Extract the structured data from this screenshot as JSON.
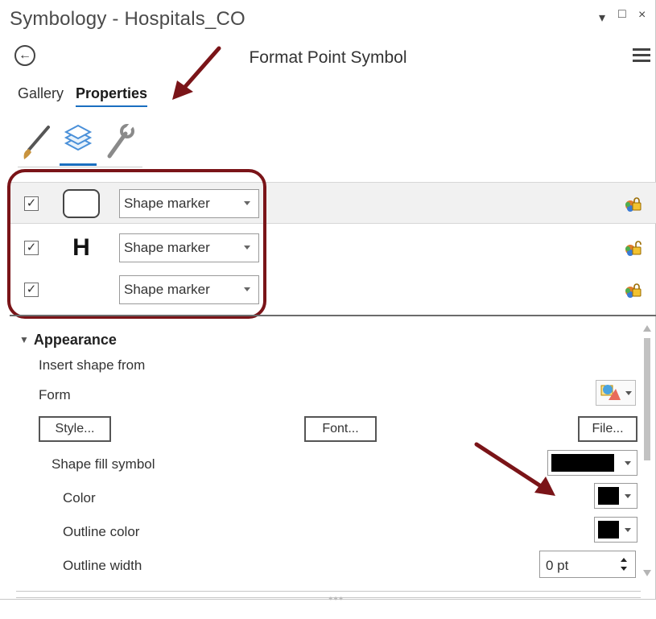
{
  "window": {
    "title": "Symbology - Hospitals_CO",
    "controls": [
      "▾",
      "□",
      "×"
    ]
  },
  "header": {
    "title": "Format Point Symbol",
    "back_icon": "back-arrow-icon",
    "menu_icon": "hamburger-menu-icon"
  },
  "tabs": [
    {
      "label": "Gallery",
      "active": false
    },
    {
      "label": "Properties",
      "active": true
    }
  ],
  "icon_tabs": [
    {
      "name": "brush-icon",
      "active": false
    },
    {
      "name": "layers-icon",
      "active": true
    },
    {
      "name": "wrench-icon",
      "active": false
    }
  ],
  "layers": [
    {
      "checked": true,
      "preview": "rounded-square",
      "preview_text": "",
      "type": "Shape marker",
      "lock": "locked"
    },
    {
      "checked": true,
      "preview": "letter",
      "preview_text": "H",
      "type": "Shape marker",
      "lock": "unlocked"
    },
    {
      "checked": true,
      "preview": "blank",
      "preview_text": "",
      "type": "Shape marker",
      "lock": "locked"
    }
  ],
  "appearance": {
    "heading": "Appearance",
    "insert_shape_from": "Insert shape from",
    "form_label": "Form",
    "style_button": "Style...",
    "font_button": "Font...",
    "file_button": "File...",
    "shape_fill_label": "Shape fill symbol",
    "color_label": "Color",
    "outline_color_label": "Outline color",
    "outline_width_label": "Outline width",
    "outline_width_value": "0 pt"
  },
  "colors": {
    "accent": "#1a6fc0",
    "annotation": "#7a1418",
    "fill": "#000000"
  }
}
